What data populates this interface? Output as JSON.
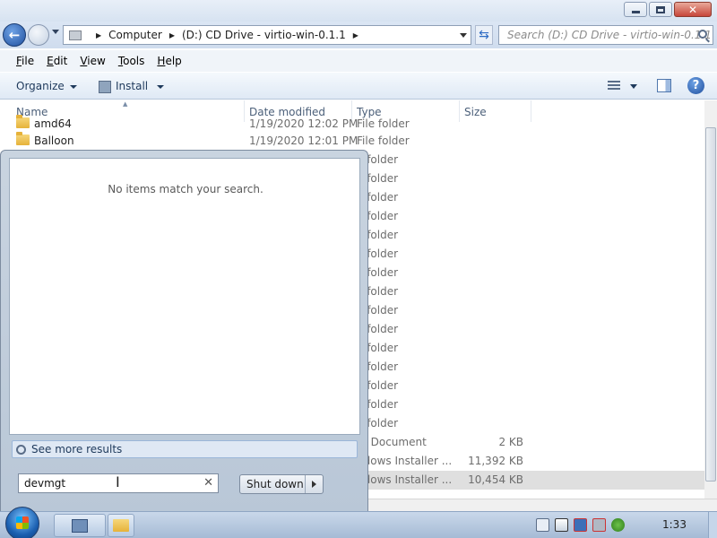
{
  "address_bar": {
    "crumbs": [
      "Computer",
      "(D:) CD Drive - virtio-win-0.1.1"
    ],
    "search_placeholder": "Search (D:) CD Drive - virtio-win-0.1.1"
  },
  "menubar": {
    "items": [
      {
        "accel": "F",
        "rest": "ile"
      },
      {
        "accel": "E",
        "rest": "dit"
      },
      {
        "accel": "V",
        "rest": "iew"
      },
      {
        "accel": "T",
        "rest": "ools"
      },
      {
        "accel": "H",
        "rest": "elp"
      }
    ]
  },
  "toolbar": {
    "organize_label": "Organize",
    "install_label": "Install"
  },
  "columns": {
    "name": "Name",
    "date": "Date modified",
    "type": "Type",
    "size": "Size"
  },
  "files": [
    {
      "name": "amd64",
      "date": "1/19/2020 12:02 PM",
      "type": "File folder",
      "size": ""
    },
    {
      "name": "Balloon",
      "date": "1/19/2020 12:01 PM",
      "type": "File folder",
      "size": ""
    },
    {
      "name": "",
      "date": "",
      "type": "e folder",
      "size": ""
    },
    {
      "name": "",
      "date": "",
      "type": "e folder",
      "size": ""
    },
    {
      "name": "",
      "date": "",
      "type": "e folder",
      "size": ""
    },
    {
      "name": "",
      "date": "",
      "type": "e folder",
      "size": ""
    },
    {
      "name": "",
      "date": "",
      "type": "e folder",
      "size": ""
    },
    {
      "name": "",
      "date": "",
      "type": "e folder",
      "size": ""
    },
    {
      "name": "",
      "date": "",
      "type": "e folder",
      "size": ""
    },
    {
      "name": "",
      "date": "",
      "type": "e folder",
      "size": ""
    },
    {
      "name": "",
      "date": "",
      "type": "e folder",
      "size": ""
    },
    {
      "name": "",
      "date": "",
      "type": "e folder",
      "size": ""
    },
    {
      "name": "",
      "date": "",
      "type": "e folder",
      "size": ""
    },
    {
      "name": "",
      "date": "",
      "type": "e folder",
      "size": ""
    },
    {
      "name": "",
      "date": "",
      "type": "e folder",
      "size": ""
    },
    {
      "name": "",
      "date": "",
      "type": "e folder",
      "size": ""
    },
    {
      "name": "",
      "date": "",
      "type": "e folder",
      "size": ""
    },
    {
      "name": "",
      "date": "",
      "type": "xt Document",
      "size": "2 KB"
    },
    {
      "name": "",
      "date": "",
      "type": "ndows Installer ...",
      "size": "11,392 KB"
    },
    {
      "name": "",
      "date": "",
      "type": "ndows Installer ...",
      "size": "10,454 KB"
    }
  ],
  "start_menu": {
    "empty_message": "No items match your search.",
    "see_more": "See more results",
    "search_value": "devmgt",
    "shutdown_label": "Shut down"
  },
  "taskbar": {
    "clock": "1:33"
  }
}
